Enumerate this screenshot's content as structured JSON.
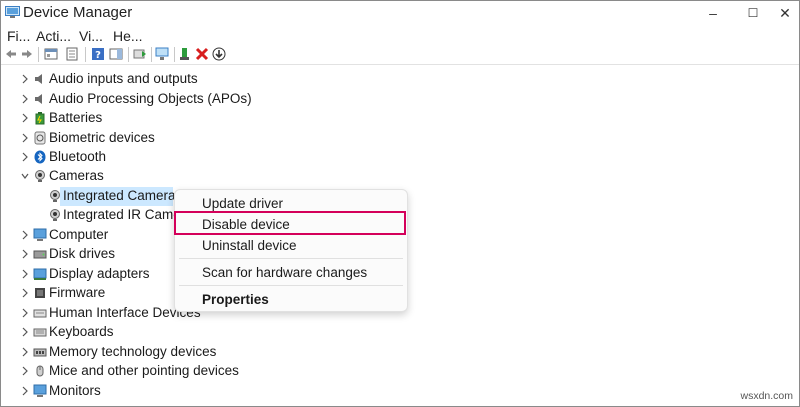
{
  "window": {
    "title": "Device Manager",
    "controls": {
      "minimize": "–",
      "maximize": "☐",
      "close": "✕"
    }
  },
  "menu": [
    "Fi...",
    "Acti...",
    "Vi...",
    "He..."
  ],
  "tree": {
    "items": [
      {
        "label": "Audio inputs and outputs",
        "icon": "speaker-icon",
        "expanded": false
      },
      {
        "label": "Audio Processing Objects (APOs)",
        "icon": "speaker-icon",
        "expanded": false
      },
      {
        "label": "Batteries",
        "icon": "battery-icon",
        "expanded": false
      },
      {
        "label": "Biometric devices",
        "icon": "fingerprint-icon",
        "expanded": false
      },
      {
        "label": "Bluetooth",
        "icon": "bluetooth-icon",
        "expanded": false
      },
      {
        "label": "Cameras",
        "icon": "camera-icon",
        "expanded": true
      },
      {
        "label": "Integrated Camera",
        "icon": "webcam-icon",
        "child": true,
        "selected": true
      },
      {
        "label": "Integrated IR Came",
        "icon": "webcam-icon",
        "child": true
      },
      {
        "label": "Computer",
        "icon": "monitor-icon",
        "expanded": false
      },
      {
        "label": "Disk drives",
        "icon": "disk-icon",
        "expanded": false
      },
      {
        "label": "Display adapters",
        "icon": "display-adapter-icon",
        "expanded": false
      },
      {
        "label": "Firmware",
        "icon": "chip-icon",
        "expanded": false
      },
      {
        "label": "Human Interface Devices",
        "icon": "hid-icon",
        "expanded": false
      },
      {
        "label": "Keyboards",
        "icon": "keyboard-icon",
        "expanded": false
      },
      {
        "label": "Memory technology devices",
        "icon": "memory-icon",
        "expanded": false
      },
      {
        "label": "Mice and other pointing devices",
        "icon": "mouse-icon",
        "expanded": false
      },
      {
        "label": "Monitors",
        "icon": "monitor-icon",
        "expanded": false
      }
    ]
  },
  "context_menu": {
    "update_driver": "Update driver",
    "disable_device": "Disable device",
    "uninstall_device": "Uninstall device",
    "scan": "Scan for hardware changes",
    "properties": "Properties",
    "highlight_color": "#d4005a"
  },
  "watermark": "wsxdn.com",
  "colors": {
    "selection": "#cce8ff",
    "accent": "#0078d4"
  }
}
